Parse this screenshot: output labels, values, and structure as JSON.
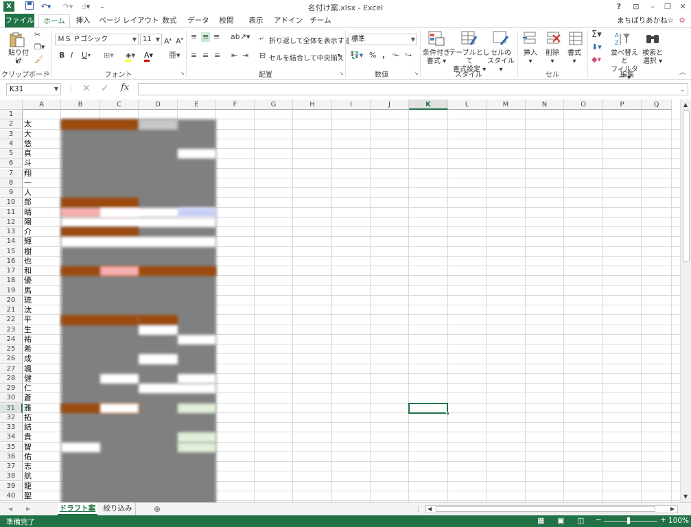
{
  "app": {
    "title": "名付け案.xlsx - Excel",
    "user": "まちばりあかね☆",
    "help": "?"
  },
  "tabs": [
    "ファイル",
    "ホーム",
    "挿入",
    "ページ レイアウト",
    "数式",
    "データ",
    "校閲",
    "表示",
    "アドイン",
    "チーム"
  ],
  "ribbon": {
    "clipboard": {
      "label": "クリップボード",
      "paste": "貼り付け"
    },
    "font": {
      "label": "フォント",
      "name": "ＭＳ Ｐゴシック",
      "size": "11",
      "bold": "B",
      "italic": "I",
      "underline": "U"
    },
    "alignment": {
      "label": "配置",
      "wrap": "折り返して全体を表示する",
      "merge": "セルを結合して中央揃え"
    },
    "number": {
      "label": "数値",
      "format": "標準",
      "percent": "%",
      "comma": ","
    },
    "styles": {
      "label": "スタイル",
      "conditional": [
        "条件付き",
        "書式"
      ],
      "table": [
        "テーブルとして",
        "書式設定"
      ],
      "cell": [
        "セルの",
        "スタイル"
      ]
    },
    "cells": {
      "label": "セル",
      "insert": "挿入",
      "delete": "削除",
      "format": "書式"
    },
    "editing": {
      "label": "編集",
      "sort": [
        "並べ替えと",
        "フィルター"
      ],
      "find": [
        "検索と",
        "選択"
      ]
    }
  },
  "namebox": "K31",
  "columns": [
    "A",
    "B",
    "C",
    "D",
    "E",
    "F",
    "G",
    "H",
    "I",
    "J",
    "K",
    "L",
    "M",
    "N",
    "O",
    "P",
    "Q"
  ],
  "selected_column": "K",
  "selected_row": 31,
  "rows": [
    "1",
    "2",
    "3",
    "4",
    "5",
    "6",
    "7",
    "8",
    "9",
    "10",
    "11",
    "12",
    "13",
    "14",
    "15",
    "16",
    "17",
    "18",
    "19",
    "20",
    "21",
    "22",
    "23",
    "24",
    "25",
    "26",
    "27",
    "28",
    "29",
    "30",
    "31",
    "32",
    "33",
    "34",
    "35",
    "36",
    "37",
    "38",
    "39",
    "40"
  ],
  "column_a": [
    "",
    "太",
    "大",
    "悠",
    "真",
    "斗",
    "翔",
    "一",
    "人",
    "郎",
    "晴",
    "陽",
    "介",
    "輝",
    "樹",
    "也",
    "和",
    "優",
    "馬",
    "琉",
    "汰",
    "平",
    "生",
    "祐",
    "希",
    "成",
    "颯",
    "健",
    "仁",
    "蒼",
    "雅",
    "拓",
    "結",
    "貴",
    "智",
    "佑",
    "志",
    "航",
    "龍",
    "聖"
  ],
  "sheets": [
    "ドラフト案",
    "絞り込み"
  ],
  "active_sheet": "ドラフト案",
  "status": {
    "ready": "準備完了",
    "zoom": "100%"
  },
  "colors": {
    "excel_green": "#217346",
    "highlight_brown": "#9c4a0e",
    "blur_gray": "#808080"
  }
}
